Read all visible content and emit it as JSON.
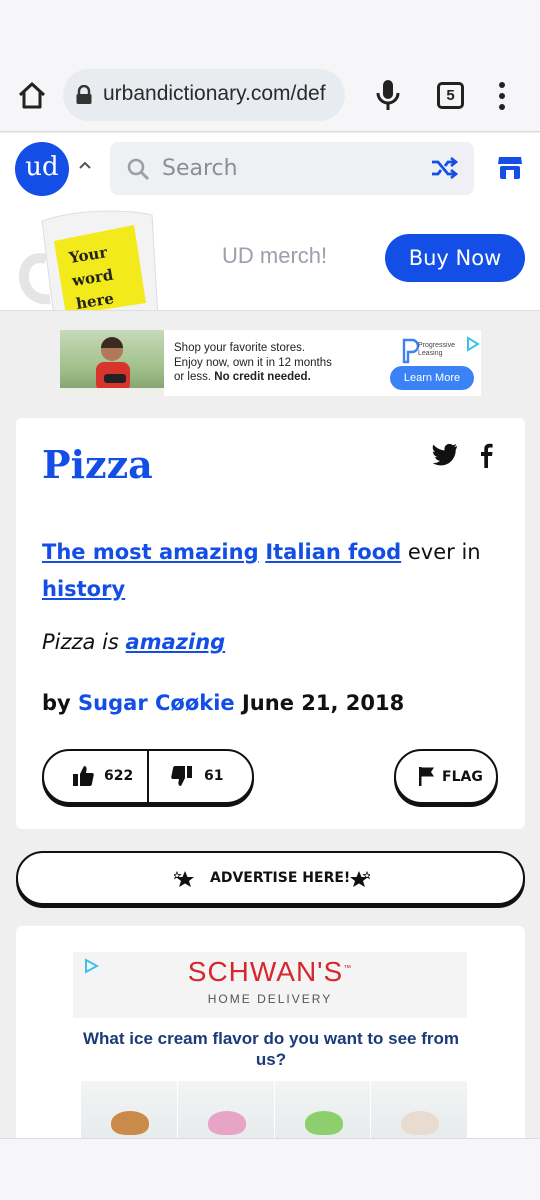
{
  "browser": {
    "url": "urbandictionary.com/def",
    "tab_count": "5"
  },
  "header": {
    "logo_text": "ud",
    "search_placeholder": "Search"
  },
  "merch": {
    "mug_text": [
      "Your",
      "word",
      "here"
    ],
    "label": "UD merch!",
    "button": "Buy Now"
  },
  "ad1": {
    "line1": "Shop your favorite stores.",
    "line2": "Enjoy now, own it in 12 months",
    "line3_plain": "or less. ",
    "line3_bold": "No credit needed.",
    "brand": "Progressive Leasing",
    "button": "Learn More"
  },
  "definition": {
    "word": "Pizza",
    "meaning_link1": "The most amazing",
    "meaning_link2": "Italian food",
    "meaning_text": " ever in",
    "meaning_link3": "history",
    "example_text": "Pizza is ",
    "example_link": "amazing",
    "by": "by ",
    "author": "Sugar Cøøkie",
    "date": " June 21, 2018",
    "upvotes": "622",
    "downvotes": "61",
    "flag": "FLAG"
  },
  "advertise": {
    "label": "ADVERTISE HERE!"
  },
  "ad2": {
    "brand": "SCHWAN'S",
    "tm": "™",
    "subtitle": "HOME DELIVERY",
    "question": "What ice cream flavor do you want to see from us?"
  },
  "colors": {
    "brand_blue": "#134fe6",
    "page_bg": "#efefef",
    "schwans_red": "#d7262c"
  }
}
